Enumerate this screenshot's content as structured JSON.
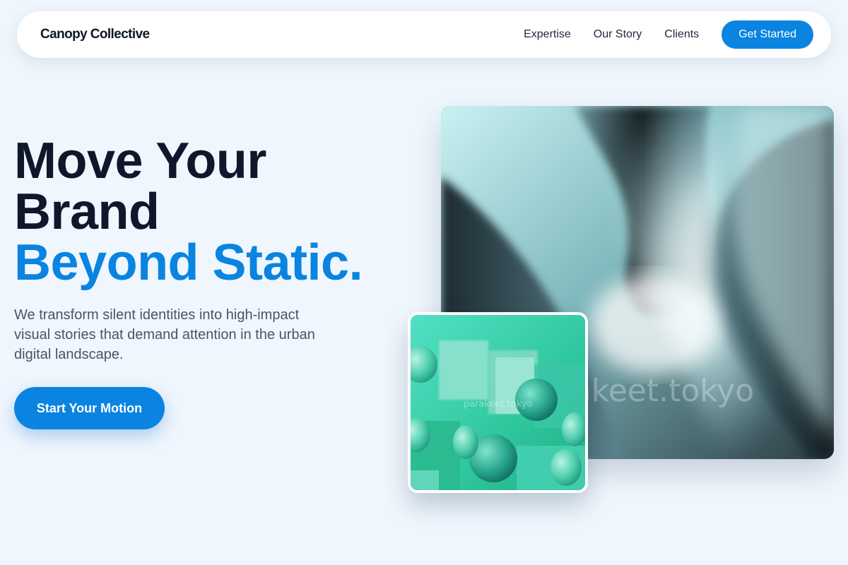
{
  "nav": {
    "brand": "Canopy Collective",
    "links": [
      "Expertise",
      "Our Story",
      "Clients"
    ],
    "cta": "Get Started"
  },
  "hero": {
    "title_line1": "Move Your",
    "title_line2": "Brand",
    "title_accent": "Beyond Static.",
    "subtitle": "We transform silent identities into high-impact visual stories that demand attention in the urban digital landscape.",
    "cta": "Start Your Motion"
  },
  "media": {
    "main_watermark": "parakeet.tokyo",
    "small_watermark": "parakeet.tokyo"
  },
  "colors": {
    "accent": "#0a84e0",
    "background": "#eff6fd",
    "heading": "#0f172a",
    "body_text": "#475569"
  }
}
